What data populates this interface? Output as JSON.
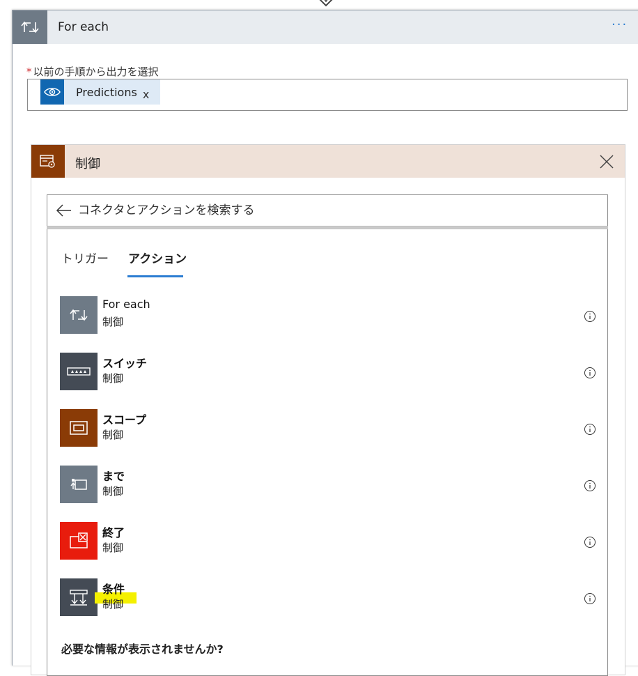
{
  "foreach_card": {
    "title": "For each",
    "more_label": "···",
    "field_label_required": "*",
    "field_label": "以前の手順から出力を選択",
    "token_label": "Predictions",
    "token_remove": "x"
  },
  "control_panel": {
    "title": "制御",
    "search_placeholder": "コネクタとアクションを検索する",
    "tabs": [
      {
        "label": "トリガー"
      },
      {
        "label": "アクション"
      }
    ],
    "items": [
      {
        "name": "For each",
        "category": "制御",
        "color": "#6e7a86",
        "icon": "foreach-loop-icon"
      },
      {
        "name": "スイッチ",
        "category": "制御",
        "color": "#444b55",
        "icon": "switch-icon"
      },
      {
        "name": "スコープ",
        "category": "制御",
        "color": "#8a3b06",
        "icon": "scope-icon"
      },
      {
        "name": "まで",
        "category": "制御",
        "color": "#6e7a86",
        "icon": "until-loop-icon"
      },
      {
        "name": "終了",
        "category": "制御",
        "color": "#e81c0d",
        "icon": "terminate-icon"
      },
      {
        "name": "条件",
        "category": "制御",
        "color": "#444b55",
        "icon": "condition-icon"
      }
    ],
    "bottom_text": "必要な情報が表示されませんか?"
  }
}
